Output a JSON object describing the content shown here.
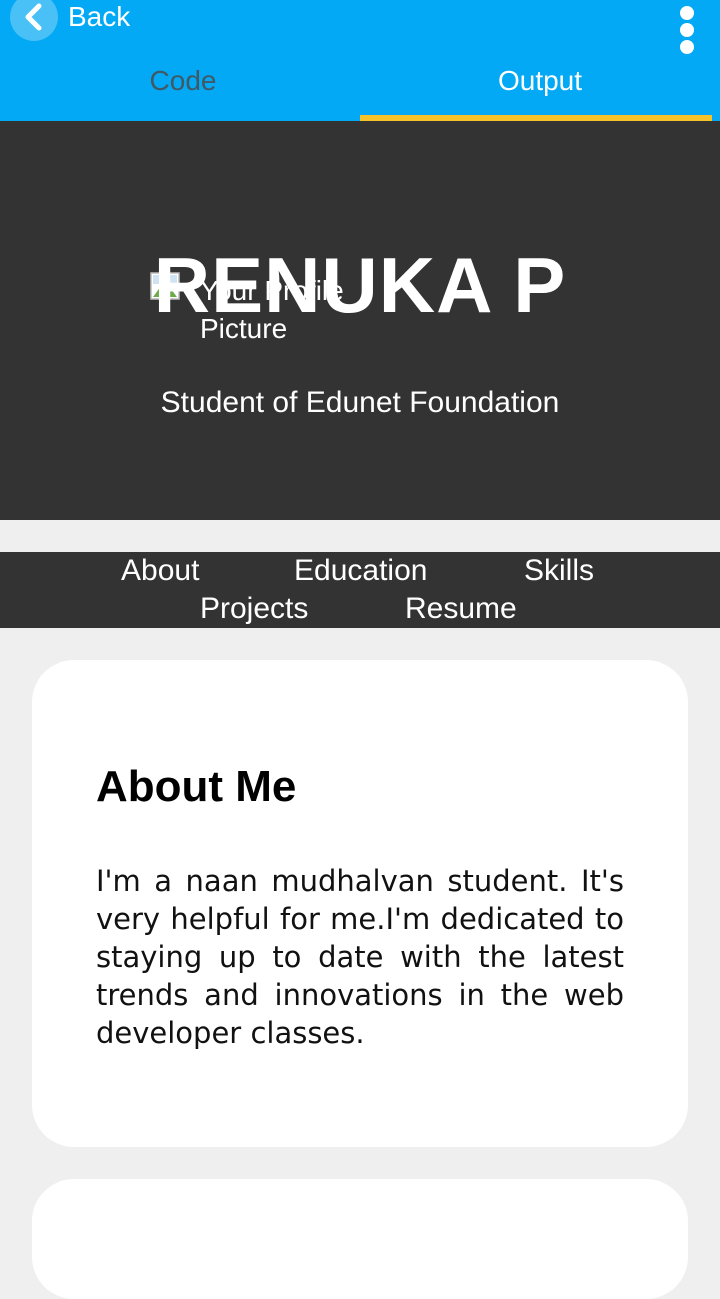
{
  "appbar": {
    "back_label": "Back",
    "tabs": [
      {
        "label": "Code",
        "active": false
      },
      {
        "label": "Output",
        "active": true
      }
    ],
    "accent_color": "#03a9f4",
    "tab_indicator_color": "#f5c22a"
  },
  "hero": {
    "name": "RENUKA P",
    "profile_alt": "Your Profile Picture",
    "subtitle": "Student of Edunet Foundation",
    "background": "#333333"
  },
  "nav": {
    "items": [
      "About",
      "Education",
      "Skills",
      "Projects",
      "Resume"
    ]
  },
  "about": {
    "title": "About Me",
    "text": "I'm a naan mudhalvan student. It's very helpful for me.I'm dedicated to staying up to date with the latest trends and innovations in the web developer classes."
  }
}
